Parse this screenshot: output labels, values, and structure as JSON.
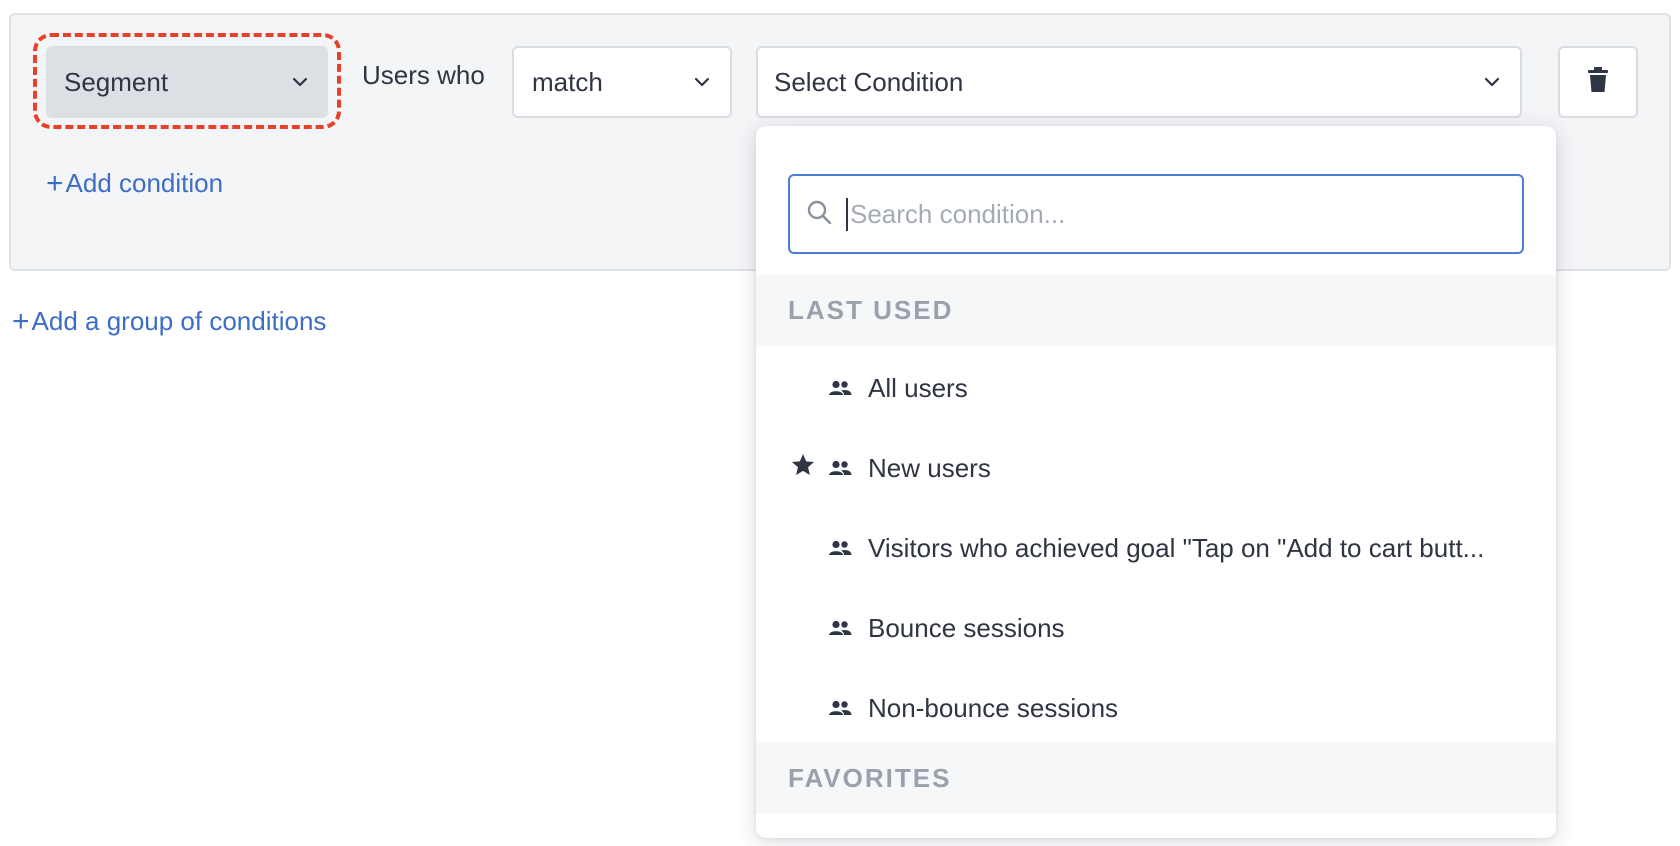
{
  "row": {
    "segment_select": {
      "value": "Segment"
    },
    "users_who_label": "Users who",
    "match_select": {
      "value": "match"
    },
    "condition_select": {
      "value": "Select Condition"
    }
  },
  "links": {
    "add_condition": "Add condition",
    "add_group": "Add a group of conditions",
    "plus": "+"
  },
  "dropdown": {
    "search": {
      "placeholder": "Search condition...",
      "value": ""
    },
    "sections": {
      "last_used": "LAST USED",
      "favorites": "FAVORITES"
    },
    "items": [
      {
        "label": "All users",
        "starred": false
      },
      {
        "label": "New users",
        "starred": true
      },
      {
        "label": "Visitors who achieved goal \"Tap on \"Add to cart butt...",
        "starred": false
      },
      {
        "label": "Bounce sessions",
        "starred": false
      },
      {
        "label": "Non-bounce sessions",
        "starred": false
      }
    ]
  },
  "icons": {
    "segment_chevron": "chevron-down-icon",
    "match_chevron": "chevron-down-icon",
    "condition_chevron": "chevron-down-icon",
    "delete": "trash-icon",
    "search": "search-icon",
    "item": "users-group-icon",
    "favorite": "star-icon"
  },
  "colors": {
    "accent": "#3d6dc5",
    "highlight_annotation": "#e8412a",
    "search_focus": "#4a7ed4"
  }
}
